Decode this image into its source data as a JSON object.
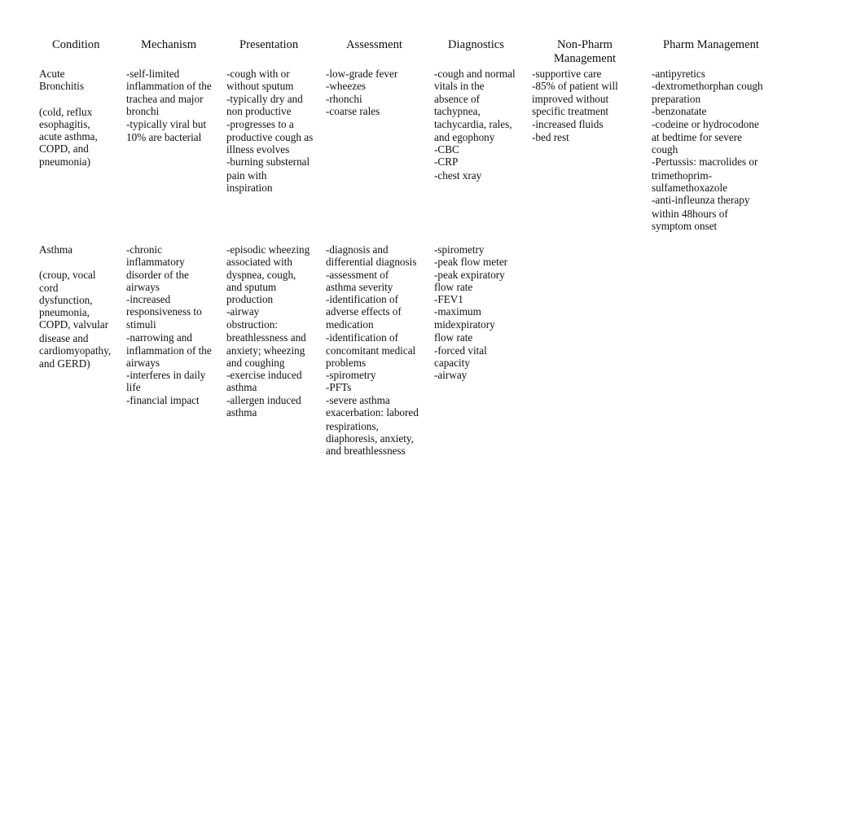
{
  "table": {
    "headers": [
      "Condition",
      "Mechanism",
      "Presentation",
      "Assessment",
      "Diagnostics",
      "Non-Pharm\nManagement",
      "Pharm Management"
    ],
    "header_lines": {
      "condition": "Condition",
      "mechanism": "Mechanism",
      "presentation": "Presentation",
      "assessment": "Assessment",
      "diagnostics": "Diagnostics",
      "nonpharm_1": "Non-Pharm",
      "nonpharm_2": "Management",
      "pharm": "Pharm Management"
    },
    "rows": [
      {
        "condition": {
          "name_lines": [
            "Acute",
            "Bronchitis"
          ],
          "differentials_lines": [
            "(cold, reflux",
            "esophagitis,",
            "acute asthma,",
            "COPD, and",
            "pneumonia)"
          ]
        },
        "mechanism": [
          "-self-limited",
          "inflammation of the",
          "trachea and major",
          "bronchi",
          "-typically viral but",
          "10% are bacterial"
        ],
        "presentation": [
          "-cough with or",
          "without sputum",
          "-typically dry and",
          "non productive",
          "-progresses to a",
          "productive cough as",
          "illness evolves",
          "-burning substernal",
          "pain with",
          "inspiration"
        ],
        "assessment": [
          "-low-grade fever",
          "-wheezes",
          "-rhonchi",
          "-coarse rales"
        ],
        "diagnostics": [
          "-cough and normal",
          "vitals in the",
          "absence of",
          "tachypnea,",
          "tachycardia, rales,",
          "and egophony",
          "-CBC",
          "-CRP",
          "-chest xray"
        ],
        "nonpharm": [
          "-supportive care",
          "-85% of patient will",
          "improved without",
          "specific treatment",
          "-increased fluids",
          "-bed rest"
        ],
        "pharm": [
          "-antipyretics",
          "-dextromethorphan cough",
          "preparation",
          "-benzonatate",
          "-codeine or hydrocodone",
          "at bedtime for severe",
          "cough",
          "-Pertussis: macrolides or",
          "trimethoprim-",
          "sulfamethoxazole",
          "-anti-infleunza therapy",
          "within 48hours of",
          "symptom onset"
        ]
      },
      {
        "condition": {
          "name_lines": [
            "Asthma"
          ],
          "differentials_lines": [
            "(croup, vocal",
            "cord",
            "dysfunction,",
            "pneumonia,",
            "COPD, valvular",
            "disease and",
            "cardiomyopathy,",
            "and GERD)"
          ]
        },
        "mechanism": [
          "-chronic",
          "inflammatory",
          "disorder of the",
          "airways",
          "-increased",
          "responsiveness to",
          "stimuli",
          "-narrowing and",
          "inflammation of the",
          "airways",
          "-interferes in daily",
          "life",
          "-financial impact"
        ],
        "presentation": [
          "-episodic wheezing",
          "associated with",
          "dyspnea, cough,",
          "and sputum",
          "production",
          "-airway",
          "obstruction:",
          "breathlessness and",
          "anxiety; wheezing",
          "and coughing",
          "-exercise induced",
          "asthma",
          "-allergen induced",
          "asthma"
        ],
        "assessment": [
          "-diagnosis and",
          "differential diagnosis",
          "-assessment of",
          "asthma severity",
          "-identification of",
          "adverse effects of",
          "medication",
          "-identification of",
          "concomitant medical",
          "problems",
          "-spirometry",
          "-PFTs",
          "-severe asthma",
          "exacerbation: labored",
          "respirations,",
          "diaphoresis, anxiety,",
          "and breathlessness"
        ],
        "diagnostics": [
          "-spirometry",
          "-peak flow meter",
          "-peak expiratory",
          "flow rate",
          "-FEV1",
          "-maximum",
          "midexpiratory",
          "flow rate",
          "-forced vital",
          "capacity",
          "-airway"
        ],
        "nonpharm": [],
        "pharm": []
      }
    ]
  }
}
